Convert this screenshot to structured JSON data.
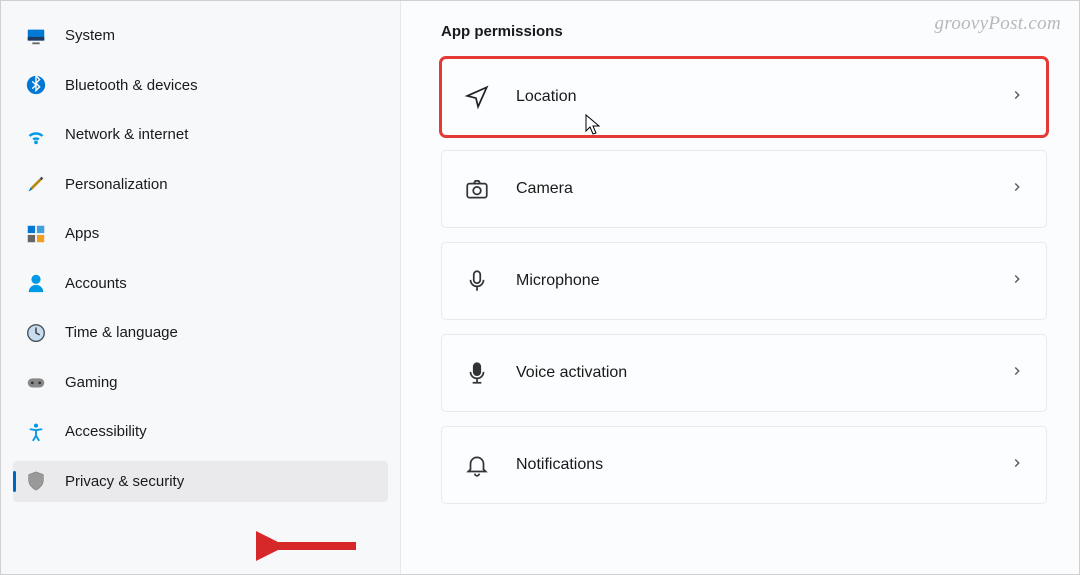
{
  "watermark": "groovyPost.com",
  "sidebar": {
    "items": [
      {
        "label": "System"
      },
      {
        "label": "Bluetooth & devices"
      },
      {
        "label": "Network & internet"
      },
      {
        "label": "Personalization"
      },
      {
        "label": "Apps"
      },
      {
        "label": "Accounts"
      },
      {
        "label": "Time & language"
      },
      {
        "label": "Gaming"
      },
      {
        "label": "Accessibility"
      },
      {
        "label": "Privacy & security"
      }
    ],
    "activeIndex": 9
  },
  "main": {
    "section_title": "App permissions",
    "cards": [
      {
        "label": "Location",
        "highlighted": true
      },
      {
        "label": "Camera"
      },
      {
        "label": "Microphone"
      },
      {
        "label": "Voice activation"
      },
      {
        "label": "Notifications"
      }
    ]
  },
  "colors": {
    "accent": "#0067c0",
    "highlight": "#e53935"
  }
}
